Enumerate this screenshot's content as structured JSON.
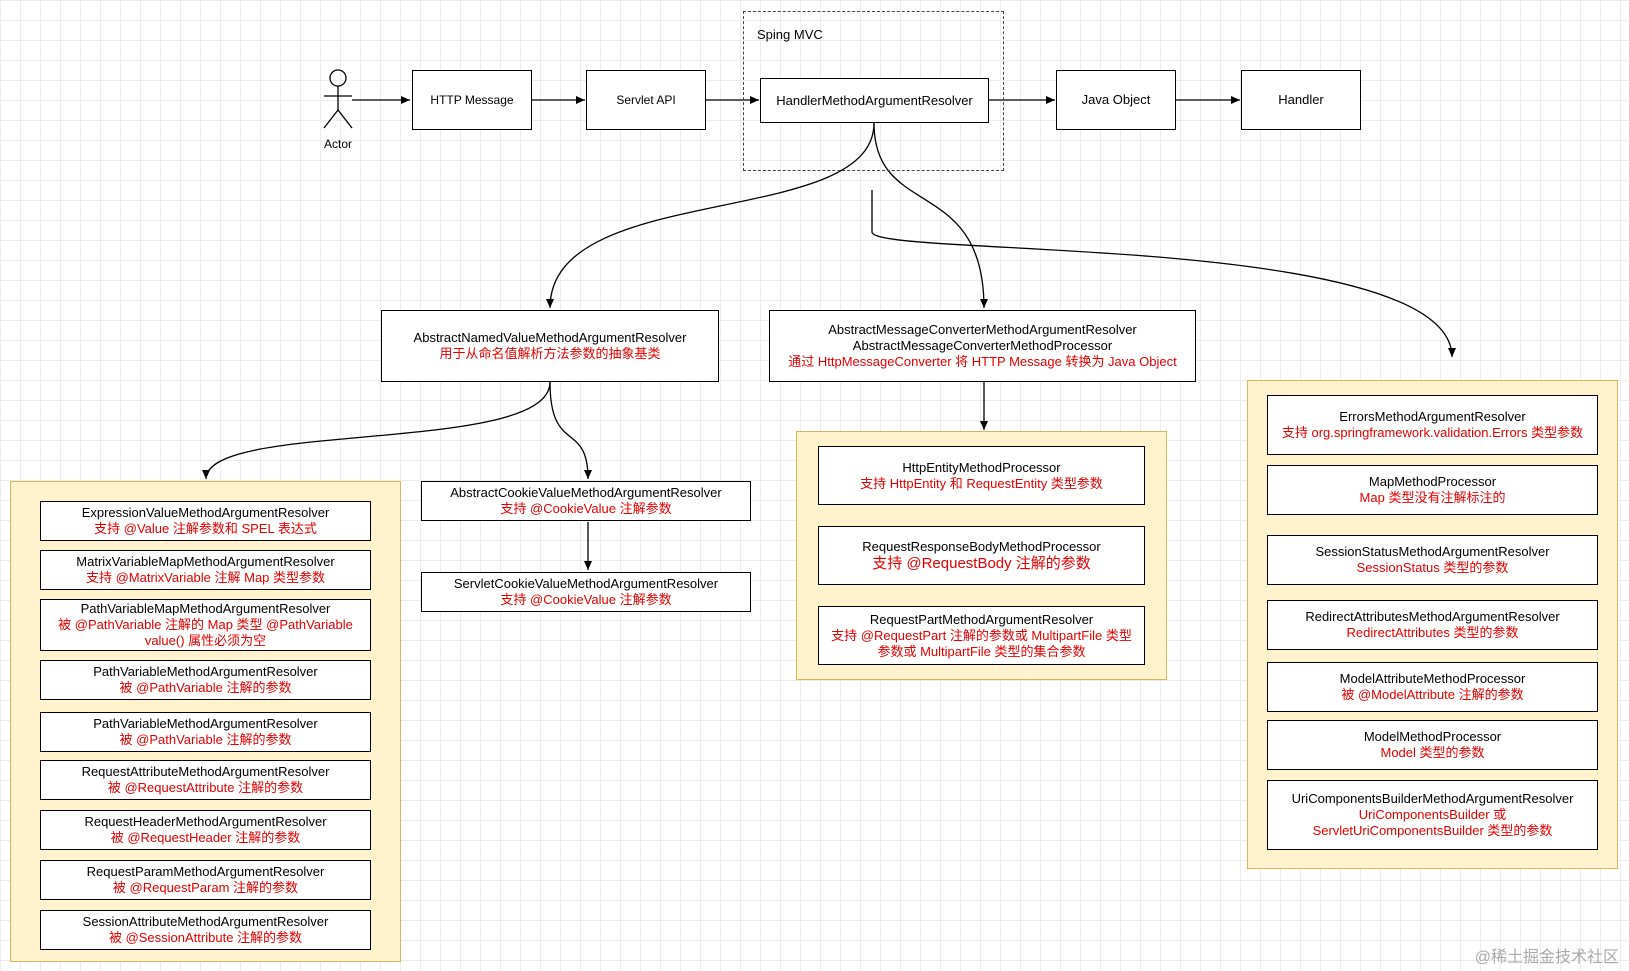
{
  "container": {
    "title": "Sping MVC"
  },
  "actor": {
    "label": "Actor"
  },
  "flow": {
    "http_message": "HTTP Message",
    "servlet_api": "Servlet API",
    "resolver": "HandlerMethodArgumentResolver",
    "java_object": "Java Object",
    "handler": "Handler"
  },
  "named": {
    "title": "AbstractNamedValueMethodArgumentResolver",
    "desc": "用于从命名值解析方法参数的抽象基类"
  },
  "converter": {
    "title1": "AbstractMessageConverterMethodArgumentResolver",
    "title2": "AbstractMessageConverterMethodProcessor",
    "desc": "通过 HttpMessageConverter 将 HTTP Message 转换为 Java Object"
  },
  "cookie": {
    "title": "AbstractCookieValueMethodArgumentResolver",
    "desc": "支持 @CookieValue 注解参数"
  },
  "servlet_cookie": {
    "title": "ServletCookieValueMethodArgumentResolver",
    "desc": "支持 @CookieValue 注解参数"
  },
  "left_group": [
    {
      "title": "ExpressionValueMethodArgumentResolver",
      "desc": "支持 @Value 注解参数和 SPEL 表达式"
    },
    {
      "title": "MatrixVariableMapMethodArgumentResolver",
      "desc": "支持 @MatrixVariable 注解 Map 类型参数"
    },
    {
      "title": "PathVariableMapMethodArgumentResolver",
      "desc": "被 @PathVariable 注解的 Map 类型 @PathVariable",
      "desc2": "value() 属性必须为空"
    },
    {
      "title": "PathVariableMethodArgumentResolver",
      "desc": "被 @PathVariable 注解的参数"
    },
    {
      "title": "PathVariableMethodArgumentResolver",
      "desc": "被 @PathVariable 注解的参数"
    },
    {
      "title": "RequestAttributeMethodArgumentResolver",
      "desc": "被 @RequestAttribute 注解的参数"
    },
    {
      "title": "RequestHeaderMethodArgumentResolver",
      "desc": "被 @RequestHeader 注解的参数"
    },
    {
      "title": "RequestParamMethodArgumentResolver",
      "desc": "被 @RequestParam 注解的参数"
    },
    {
      "title": "SessionAttributeMethodArgumentResolver",
      "desc": "被 @SessionAttribute 注解的参数"
    }
  ],
  "middle_group": [
    {
      "title": "HttpEntityMethodProcessor",
      "desc": "支持 HttpEntity 和 RequestEntity 类型参数"
    },
    {
      "title": "RequestResponseBodyMethodProcessor",
      "desc": "支持 @RequestBody 注解的参数"
    },
    {
      "title": "RequestPartMethodArgumentResolver",
      "desc": "支持 @RequestPart 注解的参数或 MultipartFile 类型",
      "desc2": "参数或 MultipartFile 类型的集合参数"
    }
  ],
  "right_group": [
    {
      "title": "ErrorsMethodArgumentResolver",
      "desc": "支持 org.springframework.validation.Errors 类型参数"
    },
    {
      "title": "MapMethodProcessor",
      "desc": "Map 类型没有注解标注的"
    },
    {
      "title": "SessionStatusMethodArgumentResolver",
      "desc": "SessionStatus 类型的参数"
    },
    {
      "title": "RedirectAttributesMethodArgumentResolver",
      "desc": "RedirectAttributes 类型的参数"
    },
    {
      "title": "ModelAttributeMethodProcessor",
      "desc": "被 @ModelAttribute 注解的参数"
    },
    {
      "title": "ModelMethodProcessor",
      "desc": "Model 类型的参数"
    },
    {
      "title": "UriComponentsBuilderMethodArgumentResolver",
      "desc": "UriComponentsBuilder 或",
      "desc2": "ServletUriComponentsBuilder 类型的参数"
    }
  ],
  "watermark": "@稀土掘金技术社区"
}
